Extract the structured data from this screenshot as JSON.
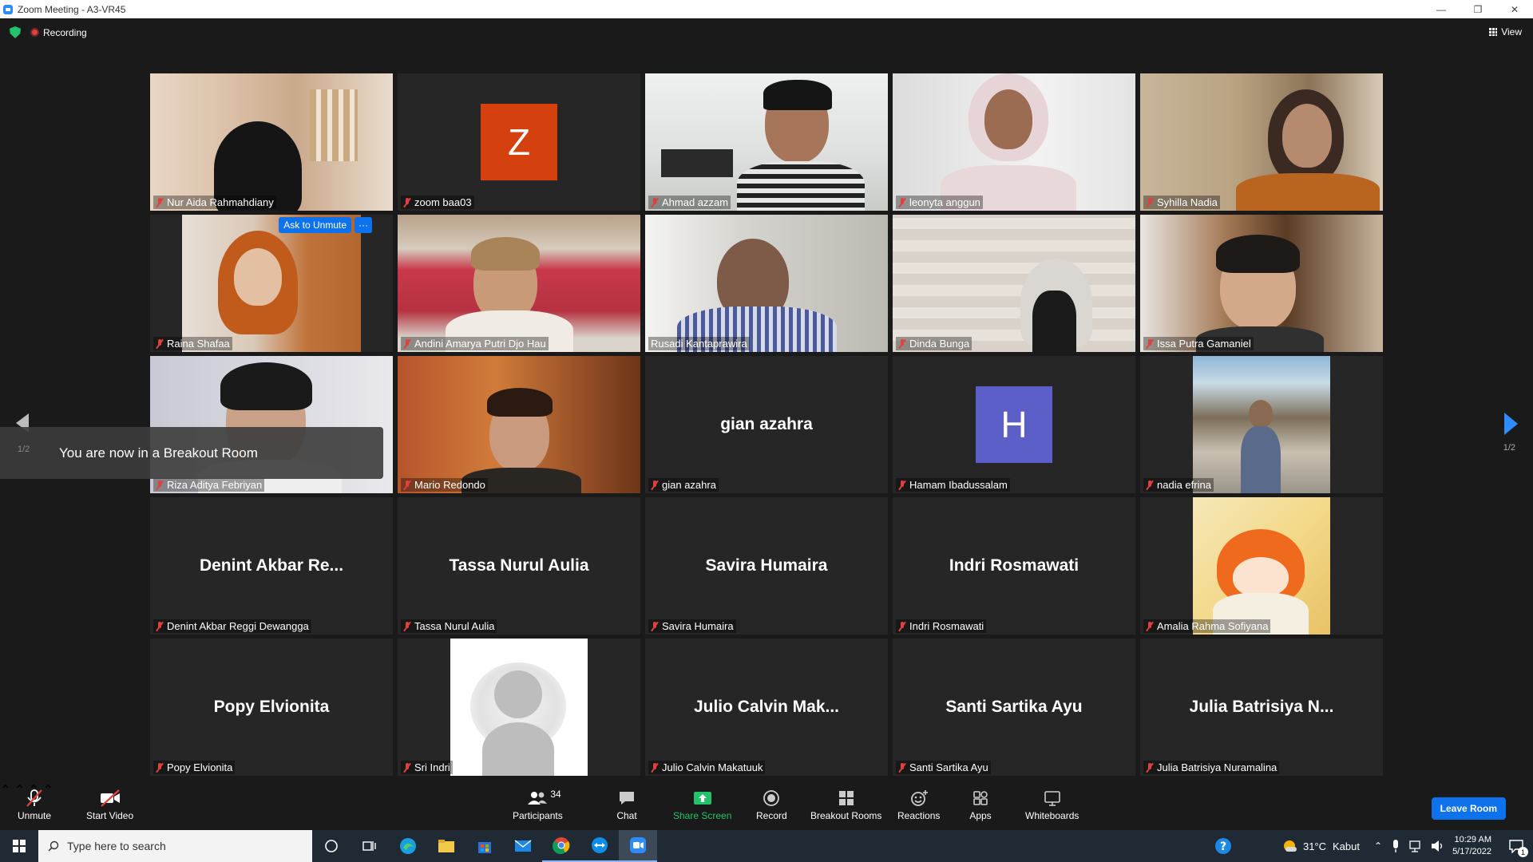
{
  "window": {
    "title": "Zoom Meeting - A3-VR45"
  },
  "top": {
    "recording_label": "Recording",
    "view_label": "View"
  },
  "tiles": [
    {
      "name": "Nur Aida Rahmahdiany"
    },
    {
      "name": "zoom baa03",
      "avatar_letter": "Z"
    },
    {
      "name": "Ahmad azzam"
    },
    {
      "name": "leonyta anggun"
    },
    {
      "name": "Syhilla Nadia"
    },
    {
      "name": "Raina Shafaa",
      "ask_unmute": "Ask to Unmute",
      "more": "···"
    },
    {
      "name": "Andini Amarya Putri Djo Hau"
    },
    {
      "name": "Rusadi Kantaprawira"
    },
    {
      "name": "Dinda Bunga"
    },
    {
      "name": "Issa Putra Gamaniel"
    },
    {
      "name": "Riza Aditya Febriyan"
    },
    {
      "name": "Mario Redondo"
    },
    {
      "name": "gian azahra",
      "display": "gian azahra"
    },
    {
      "name": "Hamam Ibadussalam",
      "avatar_letter": "H"
    },
    {
      "name": "nadia efrina"
    },
    {
      "name": "Denint Akbar Reggi Dewangga",
      "display": "Denint Akbar Re..."
    },
    {
      "name": "Tassa Nurul Aulia",
      "display": "Tassa Nurul Aulia"
    },
    {
      "name": "Savira Humaira",
      "display": "Savira Humaira"
    },
    {
      "name": "Indri Rosmawati",
      "display": "Indri Rosmawati"
    },
    {
      "name": "Amalia Rahma Sofiyana"
    },
    {
      "name": "Popy Elvionita",
      "display": "Popy Elvionita"
    },
    {
      "name": "Sri Indri"
    },
    {
      "name": "Julio Calvin Makatuuk",
      "display": "Julio Calvin Mak..."
    },
    {
      "name": "Santi Sartika Ayu",
      "display": "Santi Sartika Ayu"
    },
    {
      "name": "Julia Batrisiya Nuramalina",
      "display": "Julia Batrisiya N..."
    }
  ],
  "toast": {
    "text": "You are now in a Breakout Room",
    "page": "1/2"
  },
  "pager": {
    "right": "1/2"
  },
  "toolbar": {
    "unmute": "Unmute",
    "start_video": "Start Video",
    "participants": "Participants",
    "participants_count": "34",
    "chat": "Chat",
    "share_screen": "Share Screen",
    "record": "Record",
    "breakout_rooms": "Breakout Rooms",
    "reactions": "Reactions",
    "apps": "Apps",
    "whiteboards": "Whiteboards",
    "leave_room": "Leave Room"
  },
  "taskbar": {
    "search_placeholder": "Type here to search",
    "temperature": "31°C",
    "weather": "Kabut",
    "time": "10:29 AM",
    "date": "5/17/2022",
    "notification_count": "1"
  },
  "colors": {
    "accent": "#0e72ed",
    "muted_red": "#e0413d",
    "active_border": "#e6e14a",
    "avatar_z": "#d4410e",
    "avatar_h": "#5b5fc7"
  }
}
